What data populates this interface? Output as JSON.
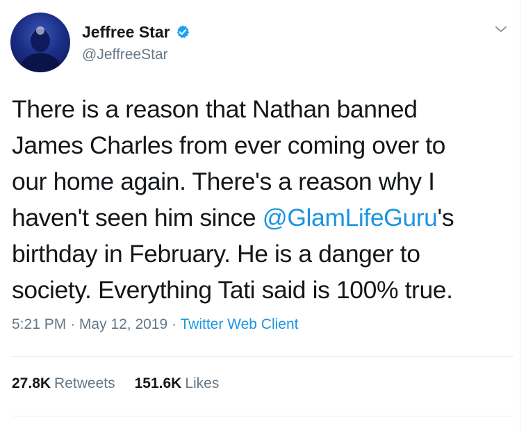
{
  "author": {
    "display_name": "Jeffree Star",
    "handle": "@JeffreeStar",
    "verified": true,
    "avatar_icon": "profile-avatar"
  },
  "tweet": {
    "lines": [
      {
        "text": "There is a reason that Nathan banned"
      },
      {
        "text": "James Charles from ever coming over to"
      },
      {
        "text": "our home again. There's a reason why I"
      },
      {
        "before": "haven't seen him since ",
        "mention": "@GlamLifeGuru",
        "after": "'s"
      },
      {
        "text": "birthday in February. He is a danger to"
      },
      {
        "text": "society. Everything Tati said is 100% true."
      }
    ]
  },
  "meta": {
    "time": "5:21 PM",
    "separator": "·",
    "date": "May 12, 2019",
    "source": "Twitter Web Client"
  },
  "stats": {
    "retweets_count": "27.8K",
    "retweets_label": "Retweets",
    "likes_count": "151.6K",
    "likes_label": "Likes"
  },
  "colors": {
    "link": "#1b95e0",
    "secondary_text": "#657786",
    "primary_text": "#14171a",
    "divider": "#e6ecf0",
    "verified_badge": "#1da1f2"
  },
  "icons": {
    "menu": "chevron-down-icon",
    "verified": "verified-badge-icon"
  }
}
